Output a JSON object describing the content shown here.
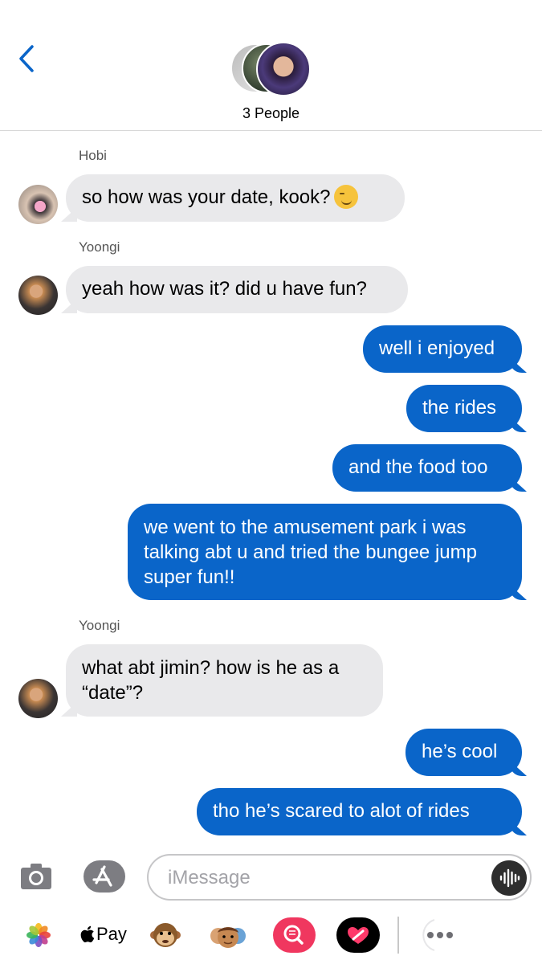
{
  "header": {
    "title": "3 People",
    "back_icon": "chevron-left-icon",
    "accent_color": "#0a65c9"
  },
  "messages": [
    {
      "sender": "Hobi",
      "direction": "incoming",
      "text": "so how was your date, kook?",
      "emoji": "smirking-face"
    },
    {
      "sender": "Yoongi",
      "direction": "incoming",
      "text": "yeah how was it? did u have fun?"
    },
    {
      "direction": "outgoing",
      "text": "well i enjoyed"
    },
    {
      "direction": "outgoing",
      "text": "the rides"
    },
    {
      "direction": "outgoing",
      "text": "and the food too"
    },
    {
      "direction": "outgoing",
      "text": "we went to the amusement park i was talking abt u and tried the bungee jump super fun!!"
    },
    {
      "sender": "Yoongi",
      "direction": "incoming",
      "text": "what abt jimin? how is he as a “date”?"
    },
    {
      "direction": "outgoing",
      "text": "he’s cool"
    },
    {
      "direction": "outgoing",
      "text": "tho he’s scared to alot of rides"
    }
  ],
  "input": {
    "placeholder": "iMessage",
    "camera_icon": "camera-icon",
    "apps_icon": "app-store-icon",
    "audio_icon": "audio-waveform-icon"
  },
  "drawer": {
    "apple_pay_label": "Pay",
    "items": [
      "photos-icon",
      "apple-pay-icon",
      "monkey-animoji-icon",
      "memoji-icon",
      "search-images-icon",
      "digital-touch-icon",
      "more-icon"
    ]
  }
}
